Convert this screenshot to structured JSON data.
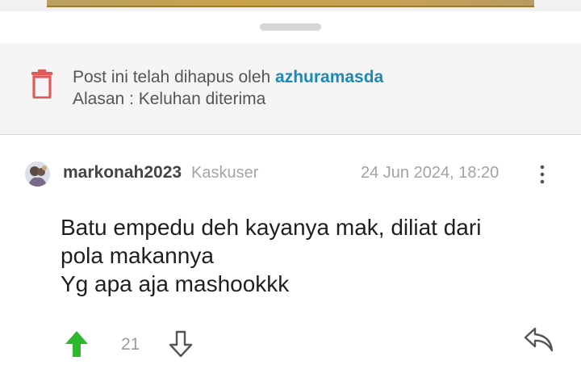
{
  "deleted_notice": {
    "text_prefix": "Post ini telah dihapus oleh ",
    "moderator": "azhuramasda",
    "reason": "Alasan : Keluhan diterima",
    "icon": "trash-icon"
  },
  "post": {
    "username": "markonah2023",
    "rank": "Kaskuser",
    "timestamp": "24 Jun 2024, 18:20",
    "lines": [
      "Batu empedu deh kayanya mak, diliat dari",
      "pola makannya",
      "Yg apa aja mashookkk"
    ],
    "vote_count": "21"
  },
  "colors": {
    "upvote": "#2eb82e",
    "trash": "#e05a5a",
    "moderator_link": "#1b88b5"
  }
}
